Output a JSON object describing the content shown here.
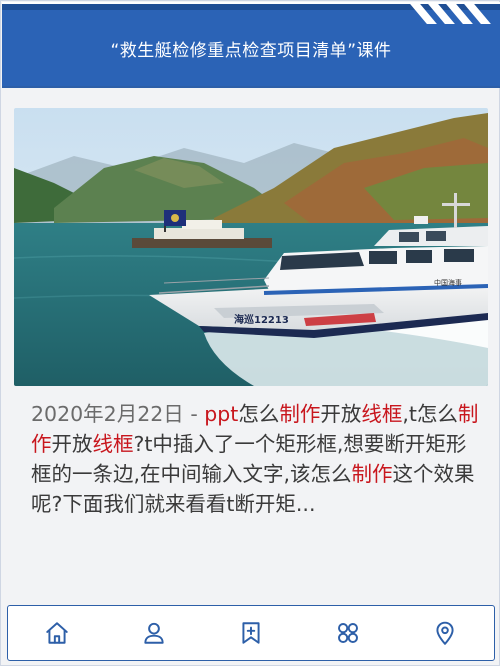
{
  "header": {
    "title": "“救生艇检修重点检查项目清单”课件"
  },
  "article": {
    "photo_alt": "海巡 12213 patrol boat on river",
    "boat_number": "海巡12213",
    "boat_label": "中国海事",
    "excerpt": {
      "date": "2020年2月22日",
      "separator": " - ",
      "parts": [
        {
          "t": "ppt",
          "kw": true
        },
        {
          "t": "怎么",
          "kw": false
        },
        {
          "t": "制作",
          "kw": true
        },
        {
          "t": "开放",
          "kw": false
        },
        {
          "t": "线框",
          "kw": true
        },
        {
          "t": ",t怎么",
          "kw": false
        },
        {
          "t": "制作",
          "kw": true
        },
        {
          "t": "开放",
          "kw": false
        },
        {
          "t": "线框",
          "kw": true
        },
        {
          "t": "?t中插入了一个矩形框,想要断开矩形框的一条边,在中间输入文字,该怎么",
          "kw": false
        },
        {
          "t": "制作",
          "kw": true
        },
        {
          "t": "这个效果呢?下面我们就来看看t断开矩...",
          "kw": false
        }
      ]
    }
  },
  "tabbar": {
    "items": [
      {
        "name": "home-icon"
      },
      {
        "name": "user-icon"
      },
      {
        "name": "bookmark-add-icon"
      },
      {
        "name": "apps-grid-icon"
      },
      {
        "name": "location-pin-icon"
      }
    ]
  },
  "colors": {
    "accent": "#2d5fa8",
    "keyword": "#c8161d",
    "header_band": "#2b63b6"
  }
}
